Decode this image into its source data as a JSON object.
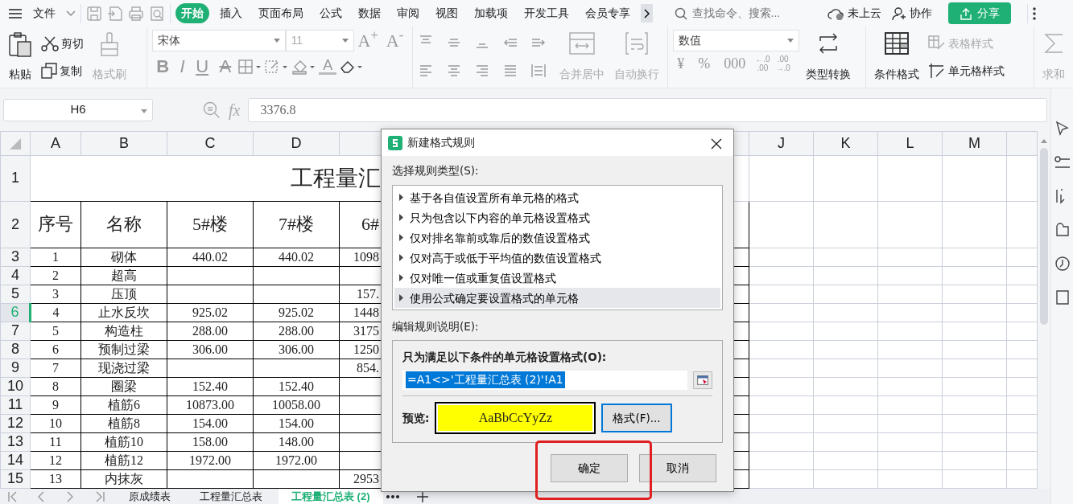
{
  "menu_bar": {
    "file_label": "文件",
    "tabs": [
      {
        "label": "开始",
        "selected": true
      },
      {
        "label": "插入",
        "selected": false
      },
      {
        "label": "页面布局",
        "selected": false
      },
      {
        "label": "公式",
        "selected": false
      },
      {
        "label": "数据",
        "selected": false
      },
      {
        "label": "审阅",
        "selected": false
      },
      {
        "label": "视图",
        "selected": false
      },
      {
        "label": "加载项",
        "selected": false
      },
      {
        "label": "开发工具",
        "selected": false
      },
      {
        "label": "会员专享",
        "selected": false
      }
    ],
    "search": {
      "placeholder": "查找命令、搜索..."
    },
    "cloud_status": "未上云",
    "collaborate": "协作",
    "share_button": "分享"
  },
  "ribbon": {
    "paste": {
      "label": "粘贴",
      "disabled": false
    },
    "cut": {
      "label": "剪切",
      "disabled": false
    },
    "copy": {
      "label": "复制",
      "disabled": false
    },
    "format_painter": {
      "label": "格式刷",
      "disabled": true
    },
    "font_name": "宋体",
    "font_size": "11",
    "grow_font": "A$^{+}$",
    "shrink_font": "A$^{-}$",
    "font_glyphs": [
      {
        "text": "B",
        "kind": "bold"
      },
      {
        "text": "I",
        "kind": "italic"
      },
      {
        "text": "U",
        "kind": "underline"
      },
      {
        "text": "A",
        "kind": "strike"
      }
    ],
    "font_color_glyph": "A",
    "merge_center": {
      "label": "合并居中",
      "disabled": true
    },
    "wrap_text": {
      "label": "自动换行",
      "disabled": true
    },
    "number_format": "数值",
    "number_buttons": [
      {
        "kind": "glyph",
        "text": "¥"
      },
      {
        "kind": "glyph",
        "text": "%"
      },
      {
        "kind": "glyph",
        "text": "000"
      },
      {
        "kind": "stack",
        "top": "←.0",
        "bottom": ".00"
      },
      {
        "kind": "stack",
        "top": ".00",
        "bottom": "→.0"
      }
    ],
    "type_convert": {
      "label": "类型转换",
      "disabled": false
    },
    "conditional_format": {
      "label": "条件格式",
      "disabled": false
    },
    "table_style": {
      "label": "表格样式",
      "disabled": true
    },
    "cell_style": {
      "label": "单元格样式",
      "disabled": false
    },
    "autosum": {
      "label": "求和",
      "disabled": true
    }
  },
  "formula_bar": {
    "name_box": "H6",
    "fx": "fx",
    "value": "3376.8"
  },
  "sheet": {
    "columns": [
      {
        "label": "A"
      },
      {
        "label": "B"
      },
      {
        "label": "C"
      },
      {
        "label": "D"
      },
      {
        "label": "J"
      },
      {
        "label": "K"
      },
      {
        "label": "L"
      },
      {
        "label": "M"
      }
    ],
    "title_row": {
      "header": "1",
      "title": "工程量汇"
    },
    "header_row": {
      "header": "2",
      "cells": [
        "序号",
        "名称",
        "5#楼",
        "7#楼",
        "6#"
      ]
    },
    "rows": [
      {
        "header": "3",
        "selected": false,
        "cells": [
          "1",
          "砌体",
          "440.02",
          "440.02",
          "1098"
        ]
      },
      {
        "header": "4",
        "selected": false,
        "cells": [
          "2",
          "超高",
          "",
          "",
          ""
        ]
      },
      {
        "header": "5",
        "selected": false,
        "cells": [
          "3",
          "压顶",
          "",
          "",
          "157."
        ]
      },
      {
        "header": "6",
        "selected": true,
        "cells": [
          "4",
          "止水反坎",
          "925.02",
          "925.02",
          "1448"
        ]
      },
      {
        "header": "7",
        "selected": false,
        "cells": [
          "5",
          "构造柱",
          "288.00",
          "288.00",
          "3175"
        ]
      },
      {
        "header": "8",
        "selected": false,
        "cells": [
          "6",
          "预制过梁",
          "306.00",
          "306.00",
          "1250"
        ]
      },
      {
        "header": "9",
        "selected": false,
        "cells": [
          "7",
          "现浇过梁",
          "",
          "",
          "854."
        ]
      },
      {
        "header": "10",
        "selected": false,
        "cells": [
          "8",
          "圈梁",
          "152.40",
          "152.40",
          ""
        ]
      },
      {
        "header": "11",
        "selected": false,
        "cells": [
          "9",
          "植筋6",
          "10873.00",
          "10058.00",
          ""
        ]
      },
      {
        "header": "12",
        "selected": false,
        "cells": [
          "10",
          "植筋8",
          "154.00",
          "154.00",
          ""
        ]
      },
      {
        "header": "13",
        "selected": false,
        "cells": [
          "11",
          "植筋10",
          "158.00",
          "148.00",
          ""
        ]
      },
      {
        "header": "14",
        "selected": false,
        "cells": [
          "12",
          "植筋12",
          "1972.00",
          "1972.00",
          ""
        ]
      },
      {
        "header": "15",
        "selected": false,
        "cells": [
          "13",
          "内抹灰",
          "",
          "",
          "2953"
        ]
      }
    ],
    "sheet_tabs": [
      {
        "label": "原成绩表",
        "selected": false
      },
      {
        "label": "工程量汇总表",
        "selected": false
      },
      {
        "label": "工程量汇总表 (2)",
        "selected": true
      }
    ]
  },
  "dialog": {
    "title": "新建格式规则",
    "rule_type_label": "选择规则类型(S):",
    "rule_types": [
      {
        "label": "基于各自值设置所有单元格的格式",
        "selected": false
      },
      {
        "label": "只为包含以下内容的单元格设置格式",
        "selected": false
      },
      {
        "label": "仅对排名靠前或靠后的数值设置格式",
        "selected": false
      },
      {
        "label": "仅对高于或低于平均值的数值设置格式",
        "selected": false
      },
      {
        "label": "仅对唯一值或重复值设置格式",
        "selected": false
      },
      {
        "label": "使用公式确定要设置格式的单元格",
        "selected": true
      }
    ],
    "description_label": "编辑规则说明(E):",
    "condition_label": "只为满足以下条件的单元格设置格式(O):",
    "formula": "=A1<>'工程量汇总表 (2)'!A1",
    "preview_label": "预览:",
    "preview_sample": "AaBbCcYyZz",
    "format_button": "格式(F)...",
    "buttons": [
      "确定",
      "取消"
    ]
  }
}
